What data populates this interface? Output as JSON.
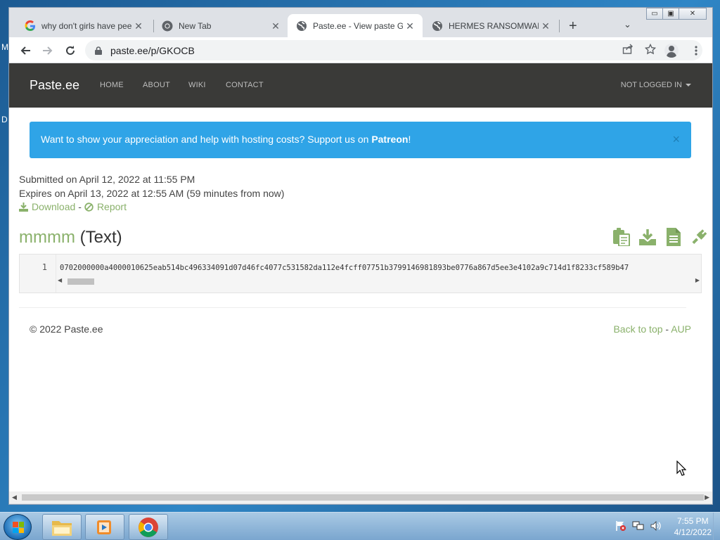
{
  "desktop": {
    "frag_top": "M",
    "frag_bottom": "D"
  },
  "browser": {
    "tabs": [
      {
        "title": "why don't girls have pee",
        "icon": "google-icon",
        "active": false
      },
      {
        "title": "New Tab",
        "icon": "chrome-icon",
        "active": false
      },
      {
        "title": "Paste.ee - View paste GKOCB",
        "icon": "globe-icon",
        "active": true
      },
      {
        "title": "HERMES RANSOMWARE",
        "icon": "globe-icon",
        "active": false
      }
    ],
    "tab_close_glyph": "✕",
    "new_tab_glyph": "+",
    "tab_list_glyph": "⌄",
    "window_controls": {
      "minimize": "▭",
      "maximize": "▣",
      "close": "✕"
    },
    "url": "paste.ee/p/GKOCB"
  },
  "site": {
    "brand": "Paste.ee",
    "nav": [
      "HOME",
      "ABOUT",
      "WIKI",
      "CONTACT"
    ],
    "account": "NOT LOGGED IN",
    "alert": {
      "text": "Want to show your appreciation and help with hosting costs? Support us on ",
      "link": "Patreon",
      "suffix": "!",
      "close": "×"
    },
    "submitted": "Submitted on April 12, 2022 at 11:55 PM",
    "expires": "Expires on April 13, 2022 at 12:55 AM (59 minutes from now)",
    "download_label": "Download",
    "action_sep": "-",
    "report_label": "Report",
    "paste_name": "mmmm",
    "paste_format": "(Text)",
    "code": {
      "line_number": "1",
      "content": "0702000000a4000010625eab514bc496334091d07d46fc4077c531582da112e4fcff07751b3799146981893be0776a867d5ee3e4102a9c714d1f8233cf589b47"
    },
    "footer_copyright": "© 2022 Paste.ee",
    "back_to_top": "Back to top",
    "footer_sep": "-",
    "aup": "AUP"
  },
  "taskbar": {
    "clock_time": "7:55 PM",
    "clock_date": "4/12/2022"
  },
  "colors": {
    "navbar": "#3a3a38",
    "alert": "#2fa4e7",
    "accent_green": "#8ab16b"
  }
}
